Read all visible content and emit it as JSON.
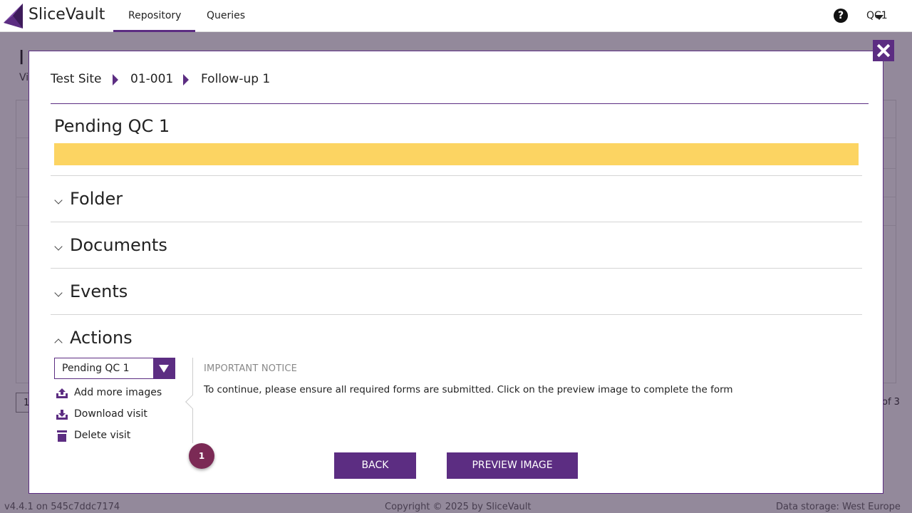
{
  "app": {
    "name": "SliceVault",
    "nav_tabs": [
      {
        "label": "Repository",
        "active": true
      },
      {
        "label": "Queries",
        "active": false
      }
    ],
    "user": "QC1",
    "accent_color": "#5c2d82"
  },
  "background": {
    "title": "I",
    "subtitle": "Vi",
    "pager_value": "1",
    "page_count": "of 3",
    "footer": {
      "version": "v4.4.1 on 545c7ddc7174",
      "copyright": "Copyright © 2025 by SliceVault",
      "storage": "Data storage: West Europe"
    }
  },
  "modal": {
    "breadcrumb": [
      "Test Site",
      "01-001",
      "Follow-up 1"
    ],
    "status": {
      "title": "Pending QC 1",
      "color": "#fcd462"
    },
    "sections": [
      {
        "label": "Folder",
        "expanded": false
      },
      {
        "label": "Documents",
        "expanded": false
      },
      {
        "label": "Events",
        "expanded": false
      },
      {
        "label": "Actions",
        "expanded": true
      }
    ],
    "actions": {
      "selected_status": "Pending QC 1",
      "items": [
        {
          "label": "Add more images",
          "icon": "upload-icon"
        },
        {
          "label": "Download visit",
          "icon": "download-icon"
        },
        {
          "label": "Delete visit",
          "icon": "trash-icon"
        }
      ]
    },
    "notice": {
      "title": "IMPORTANT NOTICE",
      "text": "To continue, please ensure all required forms are submitted. Click on the preview image to complete the form"
    },
    "badge_count": "1",
    "buttons": {
      "back": "BACK",
      "preview": "PREVIEW IMAGE"
    }
  }
}
